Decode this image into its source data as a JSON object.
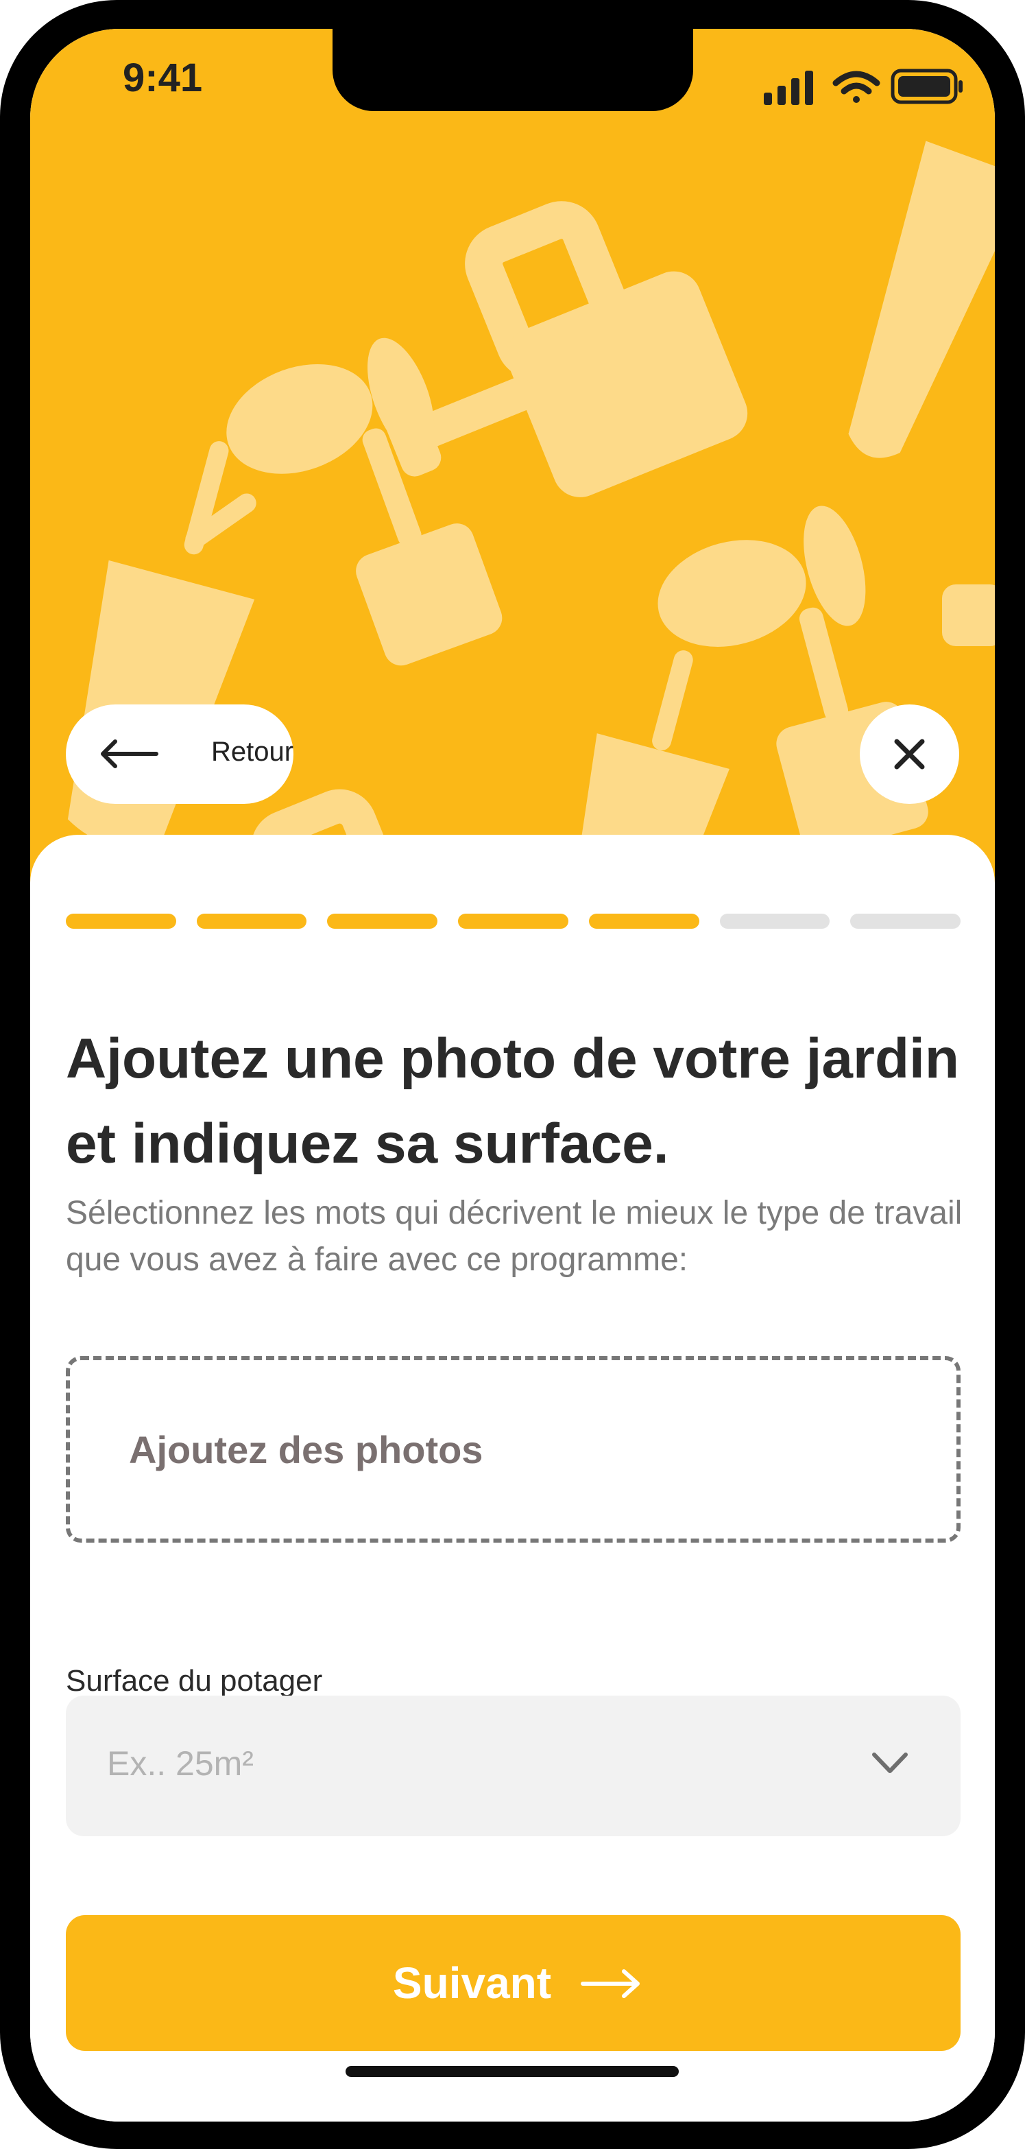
{
  "status_bar": {
    "time": "9:41"
  },
  "nav": {
    "back_label": "Retour"
  },
  "progress": {
    "total_steps": 7,
    "completed_steps": 5
  },
  "content": {
    "title": "Ajoutez une photo de votre jardin et indiquez sa surface.",
    "subtitle": "Sélectionnez les mots qui décrivent le mieux le type de travail que vous avez à faire avec ce programme:",
    "upload_label": "Ajoutez des photos",
    "surface_label": "Surface du potager",
    "surface_placeholder": "Ex.. 25m²"
  },
  "actions": {
    "next_label": "Suivant"
  },
  "colors": {
    "accent": "#FBB817",
    "pattern": "#FDDA89",
    "text": "#2A2A2A",
    "muted": "#7A7A7A"
  }
}
